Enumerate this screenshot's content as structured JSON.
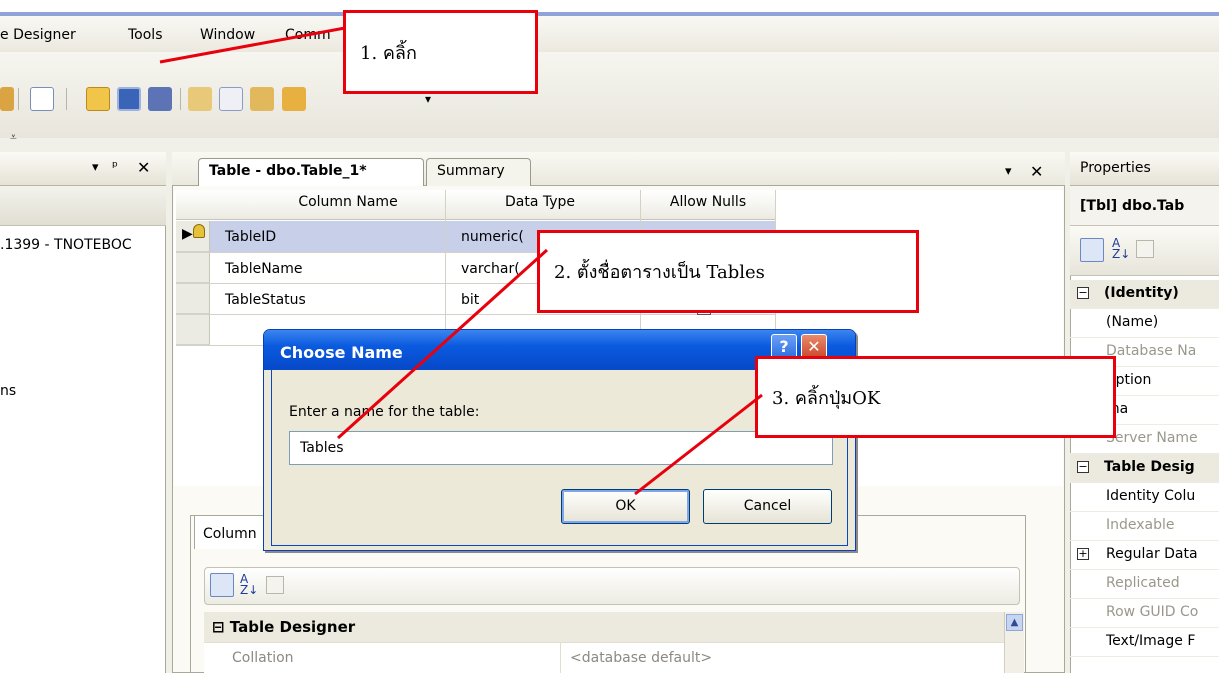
{
  "menu": {
    "items": [
      "e Designer",
      "Tools",
      "Window",
      "Comm"
    ]
  },
  "left_pane": {
    "server_label": ".1399 - TNOTEBOC",
    "truncated_item": "ns"
  },
  "document": {
    "tabs": [
      {
        "label": "Table - dbo.Table_1*",
        "active": true
      },
      {
        "label": "Summary",
        "active": false
      }
    ],
    "grid": {
      "headers": [
        "Column Name",
        "Data Type",
        "Allow Nulls"
      ],
      "rows": [
        {
          "name": "TableID",
          "type": "numeric(",
          "primary_key": true
        },
        {
          "name": "TableName",
          "type": "varchar(",
          "primary_key": false
        },
        {
          "name": "TableStatus",
          "type": "bit",
          "primary_key": false
        }
      ]
    }
  },
  "column_properties": {
    "tab_label": "Column",
    "section": "Table Designer",
    "row_label": "Collation",
    "row_value": "<database default>"
  },
  "properties_pane": {
    "title": "Properties",
    "object": "[Tbl] dbo.Tab",
    "rows": [
      {
        "label": "(Identity)",
        "kind": "section",
        "expand": "⊟"
      },
      {
        "label": "(Name)",
        "kind": "normal"
      },
      {
        "label": "Database Na",
        "kind": "dim"
      },
      {
        "label": "ription",
        "kind": "normal"
      },
      {
        "label": "ma",
        "kind": "normal"
      },
      {
        "label": "Server Name",
        "kind": "dim"
      },
      {
        "label": "Table Desig",
        "kind": "section",
        "expand": "⊟"
      },
      {
        "label": "Identity Colu",
        "kind": "normal"
      },
      {
        "label": "Indexable",
        "kind": "dim"
      },
      {
        "label": "Regular Data",
        "kind": "normal",
        "expand": "⊞"
      },
      {
        "label": "Replicated",
        "kind": "dim"
      },
      {
        "label": "Row GUID Co",
        "kind": "dim"
      },
      {
        "label": "Text/Image F",
        "kind": "normal"
      }
    ]
  },
  "dialog": {
    "title": "Choose Name",
    "help_glyph": "?",
    "close_glyph": "✕",
    "prompt": "Enter a name for the table:",
    "input_value": "Tables",
    "ok_label": "OK",
    "cancel_label": "Cancel"
  },
  "callouts": {
    "step1": "1. คลิ้ก",
    "step2": "2. ตั้งชื่อตารางเป็น Tables",
    "step3": "3. คลิ้กปุ่มOK"
  },
  "icons": {
    "pin": "ᵖ",
    "close": "✕",
    "dropdown": "▾",
    "sort_az": "A↓Z",
    "key": "key-icon"
  },
  "colors": {
    "callout_border": "#e8000d",
    "dialog_title": "#0a5ae0",
    "selected_row": "#c7d0e8"
  }
}
